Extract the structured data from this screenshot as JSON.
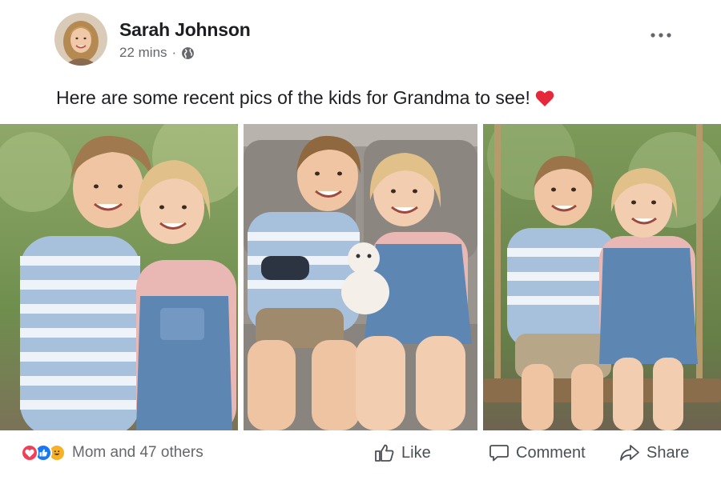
{
  "post": {
    "author": "Sarah Johnson",
    "time": "22 mins",
    "separator": "·",
    "privacy_icon": "globe-icon",
    "text": "Here are some recent pics of the kids for Grandma to see!",
    "text_emoji": "heart-icon",
    "more_icon": "more-options-icon"
  },
  "photos": [
    {
      "alt_icon": "photo-kids-hugging"
    },
    {
      "alt_icon": "photo-kids-on-couch"
    },
    {
      "alt_icon": "photo-kids-on-swing"
    }
  ],
  "reactions": {
    "icons": [
      "love-reaction-icon",
      "like-reaction-icon",
      "haha-reaction-icon"
    ],
    "summary": "Mom and 47 others"
  },
  "actions": {
    "like": "Like",
    "comment": "Comment",
    "share": "Share"
  },
  "colors": {
    "text": "#1c1e21",
    "secondary": "#65676b",
    "love": "#f33e58",
    "like": "#1877f2",
    "haha": "#f7b125"
  }
}
